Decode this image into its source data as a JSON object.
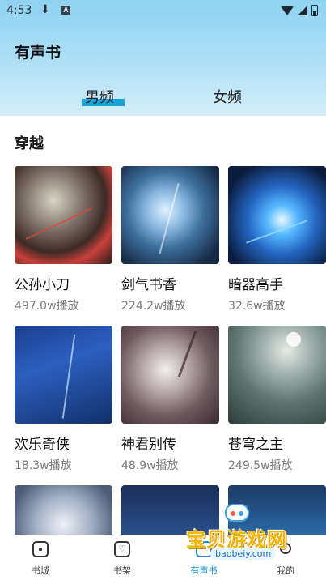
{
  "status_bar": {
    "time": "4:53"
  },
  "header": {
    "title": "有声书"
  },
  "tabs": [
    {
      "label": "男频",
      "active": true
    },
    {
      "label": "女频",
      "active": false
    }
  ],
  "section": {
    "title": "穿越",
    "books": [
      {
        "title": "公孙小刀",
        "plays": "497.0w播放"
      },
      {
        "title": "剑气书香",
        "plays": "224.2w播放"
      },
      {
        "title": "暗器高手",
        "plays": "32.6w播放"
      },
      {
        "title": "欢乐奇侠",
        "plays": "18.3w播放"
      },
      {
        "title": "神君别传",
        "plays": "48.9w播放"
      },
      {
        "title": "苍穹之主",
        "plays": "249.5w播放"
      },
      {
        "title": "",
        "plays": ""
      },
      {
        "title": "",
        "plays": ""
      },
      {
        "title": "",
        "plays": ""
      }
    ]
  },
  "bottom_nav": [
    {
      "label": "书城",
      "icon": "bookstore-icon"
    },
    {
      "label": "书架",
      "icon": "bookshelf-icon"
    },
    {
      "label": "有声书",
      "icon": "audiobook-icon",
      "active": true
    },
    {
      "label": "我的",
      "icon": "profile-icon"
    }
  ],
  "watermark": {
    "text": "宝贝游戏网",
    "url": "baobeiy.com"
  },
  "colors": {
    "accent": "#18a4dd",
    "header_top": "#8fd2f0"
  }
}
